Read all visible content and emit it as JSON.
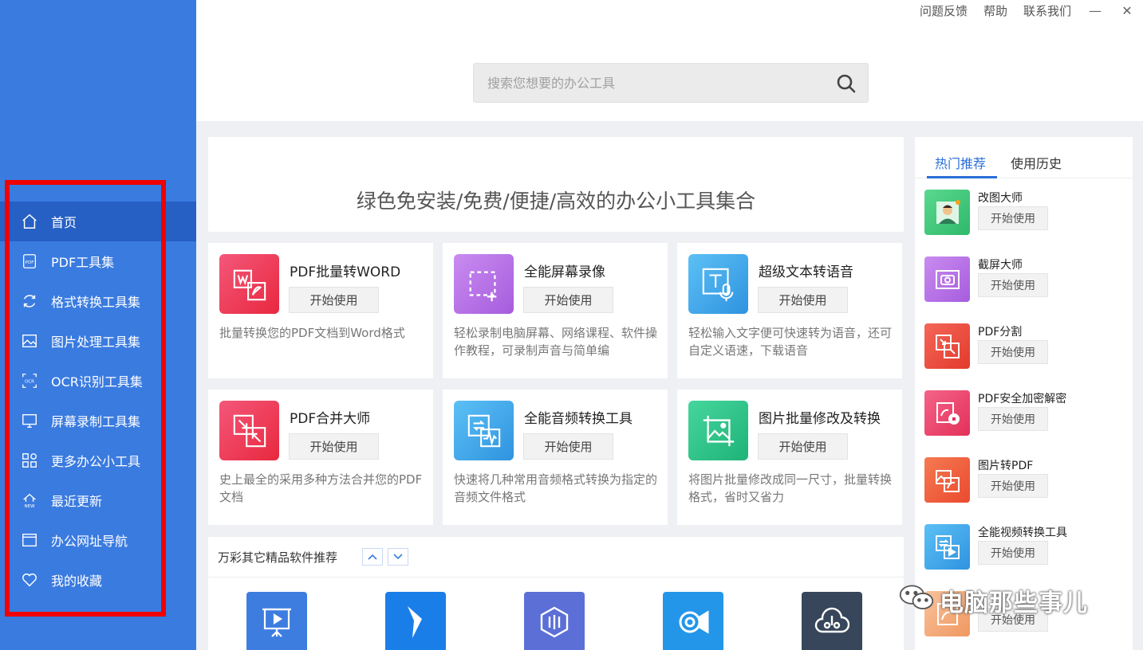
{
  "sidebar": {
    "items": [
      {
        "label": "首页",
        "icon": "home-icon"
      },
      {
        "label": "PDF工具集",
        "icon": "pdf-icon"
      },
      {
        "label": "格式转换工具集",
        "icon": "refresh-icon"
      },
      {
        "label": "图片处理工具集",
        "icon": "image-icon"
      },
      {
        "label": "OCR识别工具集",
        "icon": "ocr-icon"
      },
      {
        "label": "屏幕录制工具集",
        "icon": "monitor-icon"
      },
      {
        "label": "更多办公小工具",
        "icon": "apps-icon"
      },
      {
        "label": "最近更新",
        "icon": "new-icon"
      },
      {
        "label": "办公网址导航",
        "icon": "browser-icon"
      },
      {
        "label": "我的收藏",
        "icon": "heart-icon"
      }
    ],
    "active_index": 0,
    "colors": {
      "bg": "#3a7be0",
      "active": "#2660c4",
      "highlight": "#f00000"
    }
  },
  "topbar": {
    "links": [
      "问题反馈",
      "帮助",
      "联系我们"
    ],
    "minimize": "—",
    "close": "✕"
  },
  "search": {
    "placeholder": "搜索您想要的办公工具"
  },
  "banner": {
    "text": "绿色免安装/免费/便捷/高效的办公小工具集合"
  },
  "cards": [
    {
      "title": "PDF批量转WORD",
      "button": "开始使用",
      "desc": "批量转换您的PDF文档到Word格式",
      "color": "#ee3f5d",
      "icon": "pdf-to-word-icon"
    },
    {
      "title": "全能屏幕录像",
      "button": "开始使用",
      "desc": "轻松录制电脑屏幕、网络课程、软件操作教程，可录制声音与简单编",
      "color": "#b66fe0",
      "icon": "screen-record-icon"
    },
    {
      "title": "超级文本转语音",
      "button": "开始使用",
      "desc": "轻松输入文字便可快速转为语音，还可自定义语速，下载语音",
      "color": "#3fa6ea",
      "icon": "text-to-speech-icon"
    },
    {
      "title": "PDF合并大师",
      "button": "开始使用",
      "desc": "史上最全的采用多种方法合并您的PDF文档",
      "color": "#ee3f5d",
      "icon": "pdf-merge-icon"
    },
    {
      "title": "全能音频转换工具",
      "button": "开始使用",
      "desc": "快速将几种常用音频格式转换为指定的音频文件格式",
      "color": "#3fa6ea",
      "icon": "audio-convert-icon"
    },
    {
      "title": "图片批量修改及转换",
      "button": "开始使用",
      "desc": "将图片批量修改成同一尺寸，批量转换格式，省时又省力",
      "color": "#2bc48a",
      "icon": "image-batch-icon"
    }
  ],
  "more": {
    "title": "万彩其它精品软件推荐",
    "up": "▲",
    "down": "▼",
    "apps": [
      {
        "icon": "presentation-icon",
        "color": "#3d7de0"
      },
      {
        "icon": "video-maker-icon",
        "color": "#1a7ee8"
      },
      {
        "icon": "animation-icon",
        "color": "#5b6fd6"
      },
      {
        "icon": "camera-icon",
        "color": "#2396ea"
      },
      {
        "icon": "cloud-icon",
        "color": "#37465a"
      }
    ]
  },
  "right_panel": {
    "tabs": [
      "热门推荐",
      "使用历史"
    ],
    "items": [
      {
        "name": "改图大师",
        "button": "开始使用",
        "color": "#3ac47a",
        "icon": "avatar-photo-icon"
      },
      {
        "name": "截屏大师",
        "button": "开始使用",
        "color": "#b66fe0",
        "icon": "camera-screen-icon"
      },
      {
        "name": "PDF分割",
        "button": "开始使用",
        "color": "#ee4b3a",
        "icon": "pdf-split-icon"
      },
      {
        "name": "PDF安全加密解密",
        "button": "开始使用",
        "color": "#ee3f6d",
        "icon": "pdf-lock-icon"
      },
      {
        "name": "图片转PDF",
        "button": "开始使用",
        "color": "#f0573a",
        "icon": "image-to-pdf-icon"
      },
      {
        "name": "全能视频转换工具",
        "button": "开始使用",
        "color": "#3fa6ea",
        "icon": "video-convert-icon"
      },
      {
        "name": "",
        "button": "开始使用",
        "color": "#f5a875",
        "icon": "pdf-icon"
      }
    ]
  },
  "watermark": {
    "text": "电脑那些事儿"
  }
}
